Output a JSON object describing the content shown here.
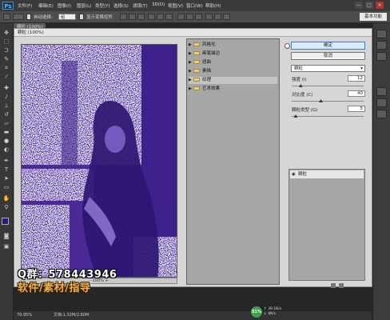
{
  "app": {
    "logo": "Ps",
    "menu": [
      "文件(F)",
      "编辑(E)",
      "图像(I)",
      "图层(L)",
      "类型(Y)",
      "选择(S)",
      "滤镜(T)",
      "3D(D)",
      "视图(V)",
      "窗口(W)",
      "帮助(H)"
    ],
    "window_controls": [
      "—",
      "□",
      "✕"
    ]
  },
  "options_bar": {
    "auto_select_label": "自动选择:",
    "auto_select_value": "组",
    "show_transform_label": "显示变换控件",
    "workspace": "基本功能"
  },
  "document": {
    "tab": "颗粒 (100%)",
    "zoom": "79.95%",
    "doc_info": "文档:1.32M/2.60M"
  },
  "dialog": {
    "title": "颗粒 (100%)",
    "zoom_controls": "- 100% +",
    "filter_folders": [
      {
        "label": "风格化",
        "selected": false
      },
      {
        "label": "画笔描边",
        "selected": false
      },
      {
        "label": "扭曲",
        "selected": false
      },
      {
        "label": "素描",
        "selected": false
      },
      {
        "label": "纹理",
        "selected": true
      },
      {
        "label": "艺术效果",
        "selected": false
      }
    ],
    "ok_label": "确定",
    "cancel_label": "取消",
    "filter_select": "颗粒",
    "params": [
      {
        "label": "强度 (I)",
        "value": "12",
        "fraction": 0.12
      },
      {
        "label": "对比度 (C)",
        "value": "40",
        "fraction": 0.4
      },
      {
        "label": "颗粒类型 (G)",
        "value": "5",
        "fraction": 0.05
      }
    ],
    "layer_name": "颗粒"
  },
  "watermark": {
    "line1": "Q群：578443946",
    "line2": "软件/素材/指导"
  },
  "tray": {
    "badge": "51%",
    "up": "↑ 39.1K/s",
    "down": "↓ 4K/s"
  },
  "colors": {
    "preview_bg": "#4b2a98",
    "preview_dots": "#c9c2ee",
    "watermark_line1": "#ffffff",
    "watermark_line2": "#f0b24a",
    "ps_blue": "#5fb4ff"
  }
}
